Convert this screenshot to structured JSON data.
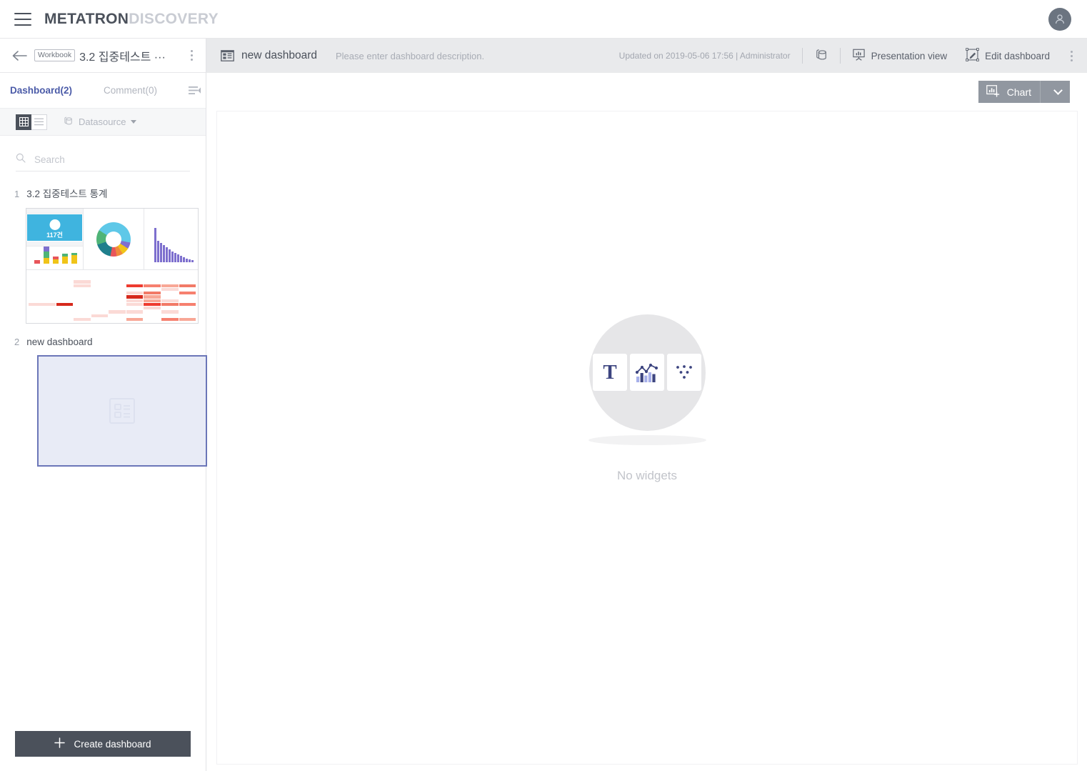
{
  "gnb": {
    "menu_icon": "hamburger-icon",
    "logo_primary": "METATRON",
    "logo_secondary": "DISCOVERY",
    "avatar_icon": "user-avatar-icon"
  },
  "workbook_bar": {
    "back_icon": "back-arrow-icon",
    "badge": "Workbook",
    "title": "3.2 집중테스트 ···",
    "more_icon": "kebab-menu-icon"
  },
  "dashboard_bar": {
    "dashboard_icon": "dashboard-icon",
    "title": "new dashboard",
    "description_placeholder": "Please enter dashboard description.",
    "updated_text": "Updated on 2019-05-06 17:56 | Administrator",
    "datasource_icon": "datasource-icon",
    "presentation_icon": "presentation-icon",
    "presentation_label": "Presentation view",
    "edit_icon": "edit-pencil-icon",
    "edit_label": "Edit dashboard",
    "more_icon": "kebab-menu-icon"
  },
  "left_panel": {
    "tabs": [
      {
        "label": "Dashboard(2)",
        "active": true
      },
      {
        "label": "Comment(0)",
        "active": false
      }
    ],
    "collapse_icon": "collapse-panel-icon",
    "view_toggle": {
      "grid_icon": "grid-view-icon",
      "list_icon": "list-view-icon",
      "active": "grid"
    },
    "datasource_filter": {
      "icon": "datasource-icon",
      "label": "Datasource",
      "caret_icon": "chevron-down-icon"
    },
    "search": {
      "icon": "search-icon",
      "placeholder": "Search",
      "value": ""
    },
    "dashboards": [
      {
        "num": "1",
        "name": "3.2 집중테스트 통계",
        "selected": false,
        "kpi_value": "117건"
      },
      {
        "num": "2",
        "name": "new dashboard",
        "selected": true
      }
    ],
    "create_button": {
      "icon": "plus-icon",
      "label": "Create dashboard"
    }
  },
  "main": {
    "chart_button": {
      "icon": "add-chart-icon",
      "label": "Chart",
      "caret_icon": "chevron-down-icon"
    },
    "empty_state": {
      "label": "No widgets",
      "tiles": [
        {
          "name": "text-widget-icon",
          "glyph": "T"
        },
        {
          "name": "chart-widget-icon"
        },
        {
          "name": "filter-widget-icon"
        }
      ]
    }
  },
  "colors": {
    "accent": "#4b5ba8",
    "dark": "#4b515b",
    "toolbar_bg": "#e9eaec",
    "selected_thumb_border": "#6b76b8",
    "selected_thumb_bg": "#e8ebf6",
    "chart_button_bg": "#9197a0"
  }
}
